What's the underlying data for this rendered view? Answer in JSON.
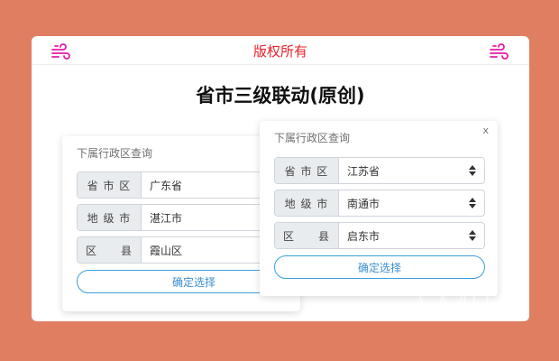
{
  "header": {
    "copyright": "版权所有",
    "left_icon": "wind-icon",
    "right_icon": "wind-icon",
    "icon_color": "#e61aa6"
  },
  "page": {
    "title": "省市三级联动(原创)"
  },
  "panel_left": {
    "title": "下属行政区查询",
    "rows": [
      {
        "label": "省 市 区",
        "value": "广东省"
      },
      {
        "label": "地 级 市",
        "value": "湛江市"
      },
      {
        "label": "区　　县",
        "value": "霞山区"
      }
    ],
    "button": "确定选择"
  },
  "panel_right": {
    "title": "下属行政区查询",
    "close": "x",
    "rows": [
      {
        "label": "省 市 区",
        "value": "江苏省"
      },
      {
        "label": "地 级 市",
        "value": "南通市"
      },
      {
        "label": "区　　县",
        "value": "启东市"
      }
    ],
    "button": "确定选择"
  },
  "colors": {
    "background": "#e07e62",
    "copyright_text": "#e8202a",
    "button_border": "#3b9fe0"
  }
}
